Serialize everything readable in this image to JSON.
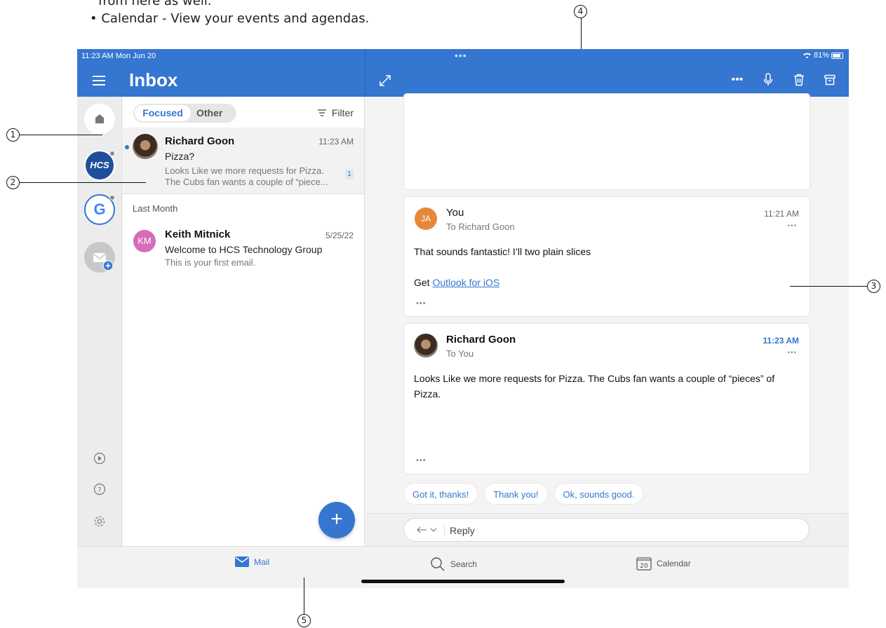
{
  "doc": {
    "line_top": "from here as well.",
    "line_calendar": "• Calendar - View your events and agendas."
  },
  "callouts": [
    "1",
    "2",
    "3",
    "4",
    "5"
  ],
  "status_bar": {
    "time_date": "11:23 AM  Mon Jun 20",
    "battery": "81%"
  },
  "header": {
    "title": "Inbox"
  },
  "account_rail": {
    "hcs_label": "HCS",
    "google_label": "G",
    "icons": [
      "home-icon",
      "hcs-account-icon",
      "google-account-icon",
      "add-mail-account-icon",
      "play-icon",
      "help-icon",
      "gear-icon"
    ]
  },
  "message_list": {
    "tabs": {
      "focused": "Focused",
      "other": "Other"
    },
    "filter_label": "Filter",
    "section_last_month": "Last Month",
    "messages": [
      {
        "sender": "Richard Goon",
        "time": "11:23 AM",
        "subject": "Pizza?",
        "preview_line1": "Looks Like we more requests for Pizza.",
        "preview_line2": "The Cubs fan wants a couple of “piece...",
        "count_badge": "1",
        "unread": true
      },
      {
        "sender": "Keith Mitnick",
        "initials": "KM",
        "time": "5/25/22",
        "subject": "Welcome to HCS Technology Group",
        "preview": "This is your first email."
      }
    ]
  },
  "reading_pane": {
    "messages": [
      {
        "from": "You",
        "initials": "JA",
        "to": "To Richard Goon",
        "time": "11:21 AM",
        "body_line1": "That sounds fantastic! I’ll two plain slices",
        "signature_prefix": "Get ",
        "signature_link": "Outlook for iOS"
      },
      {
        "from": "Richard Goon",
        "to": "To You",
        "time": "11:23 AM",
        "body": "Looks Like we more requests for Pizza. The Cubs fan wants a couple of “pieces” of Pizza."
      }
    ],
    "quick_replies": [
      "Got it, thanks!",
      "Thank you!",
      "Ok, sounds good."
    ],
    "reply_label": "Reply"
  },
  "tab_bar": {
    "mail": "Mail",
    "search": "Search",
    "calendar": "Calendar",
    "calendar_day": "20"
  },
  "colors": {
    "accent": "#3476d0",
    "km_avatar": "#d76cb8",
    "ja_avatar": "#e6883a"
  }
}
